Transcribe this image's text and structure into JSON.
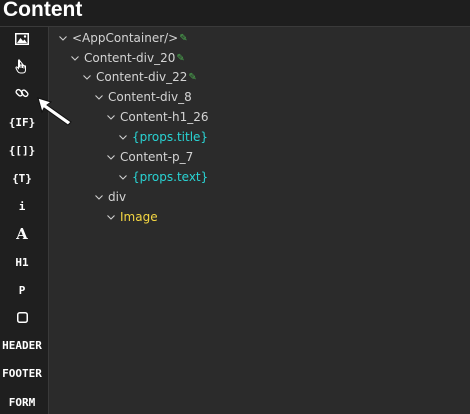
{
  "header": {
    "title": "Content"
  },
  "sidebar": {
    "items": [
      {
        "label": "",
        "icon": "image-icon"
      },
      {
        "label": "",
        "icon": "hand-pointer-icon"
      },
      {
        "label": "",
        "icon": "link-icon"
      },
      {
        "label": "{IF}"
      },
      {
        "label": "{[]}"
      },
      {
        "label": "{T}"
      },
      {
        "label": "i"
      },
      {
        "label": "A"
      },
      {
        "label": "H1"
      },
      {
        "label": "P"
      },
      {
        "label": "",
        "icon": "square-icon"
      },
      {
        "label": "HEADER"
      },
      {
        "label": "FOOTER"
      },
      {
        "label": "FORM"
      }
    ]
  },
  "tree": {
    "nodes": [
      {
        "label": "<AppContainer/>",
        "depth": 0,
        "expanded": true,
        "editable": true
      },
      {
        "label": "Content-div_20",
        "depth": 1,
        "expanded": true,
        "editable": true
      },
      {
        "label": "Content-div_22",
        "depth": 2,
        "expanded": true,
        "editable": true
      },
      {
        "label": "Content-div_8",
        "depth": 3,
        "expanded": true,
        "editable": false
      },
      {
        "label": "Content-h1_26",
        "depth": 4,
        "expanded": true,
        "editable": false
      },
      {
        "label": "{props.title}",
        "depth": 5,
        "expanded": true,
        "editable": false,
        "kind": "prop"
      },
      {
        "label": "Content-p_7",
        "depth": 4,
        "expanded": true,
        "editable": false
      },
      {
        "label": "{props.text}",
        "depth": 5,
        "expanded": true,
        "editable": false,
        "kind": "prop"
      },
      {
        "label": "div",
        "depth": 3,
        "expanded": true,
        "editable": false
      },
      {
        "label": "Image",
        "depth": 4,
        "expanded": true,
        "editable": false,
        "kind": "component"
      }
    ]
  },
  "colors": {
    "prop": "#29d3d3",
    "component": "#f5d742",
    "edit": "#4caf50",
    "background": "#2b2b2b",
    "sidebar": "#1f1f1f"
  }
}
